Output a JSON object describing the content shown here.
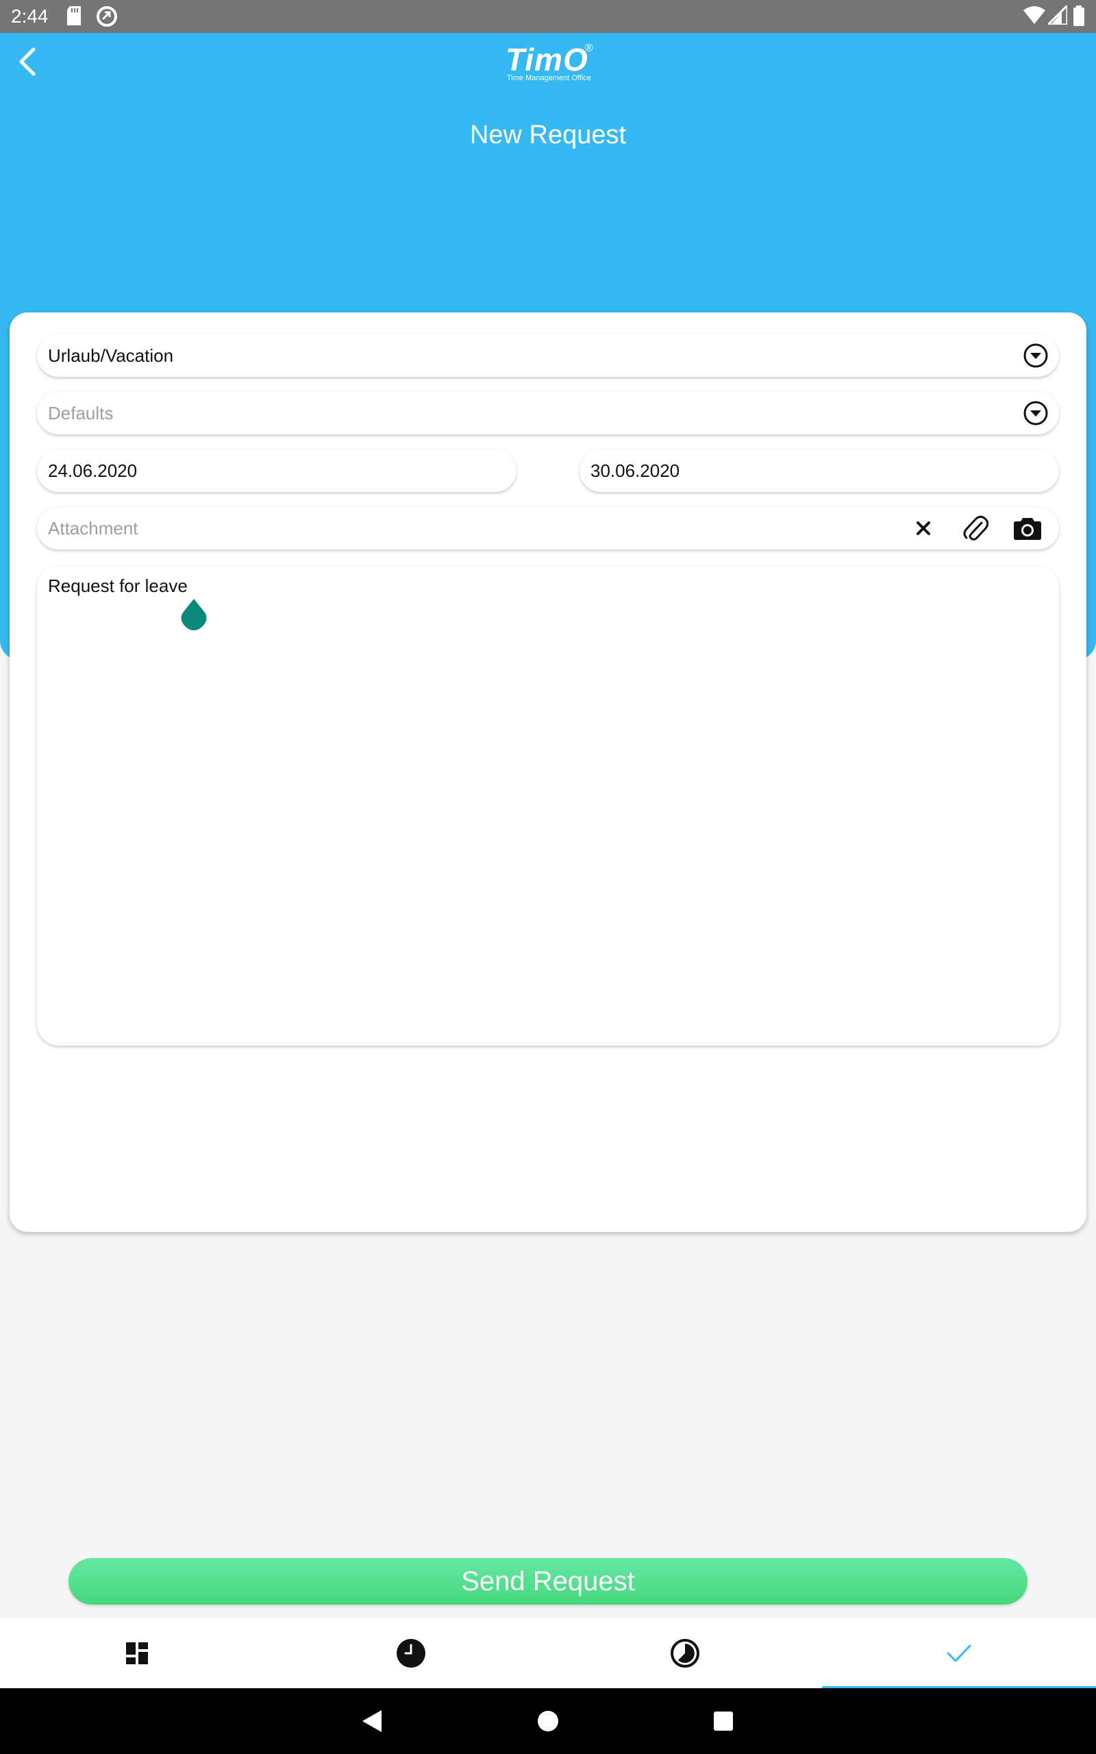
{
  "status_bar": {
    "time": "2:44"
  },
  "header": {
    "logo": {
      "word": "TimO",
      "registered": "®",
      "tagline": "Time Management Office"
    },
    "title": "New Request"
  },
  "form": {
    "request_type": {
      "value": "Urlaub/Vacation"
    },
    "defaults": {
      "placeholder": "Defaults"
    },
    "start_date": {
      "value": "24.06.2020"
    },
    "end_date": {
      "value": "30.06.2020"
    },
    "attachment": {
      "placeholder": "Attachment"
    },
    "comment": {
      "value": "Request for leave"
    }
  },
  "actions": {
    "send_label": "Send Request"
  },
  "bottom_nav": {
    "items": [
      {
        "icon": "dashboard-icon"
      },
      {
        "icon": "clock-icon"
      },
      {
        "icon": "timer-icon"
      },
      {
        "icon": "check-icon",
        "active": true
      }
    ]
  },
  "colors": {
    "header_bg": "#36b9f2",
    "send_button": "#4fdf8a",
    "active_tab": "#36b9f2",
    "cursor_handle": "#0a8a7a"
  }
}
